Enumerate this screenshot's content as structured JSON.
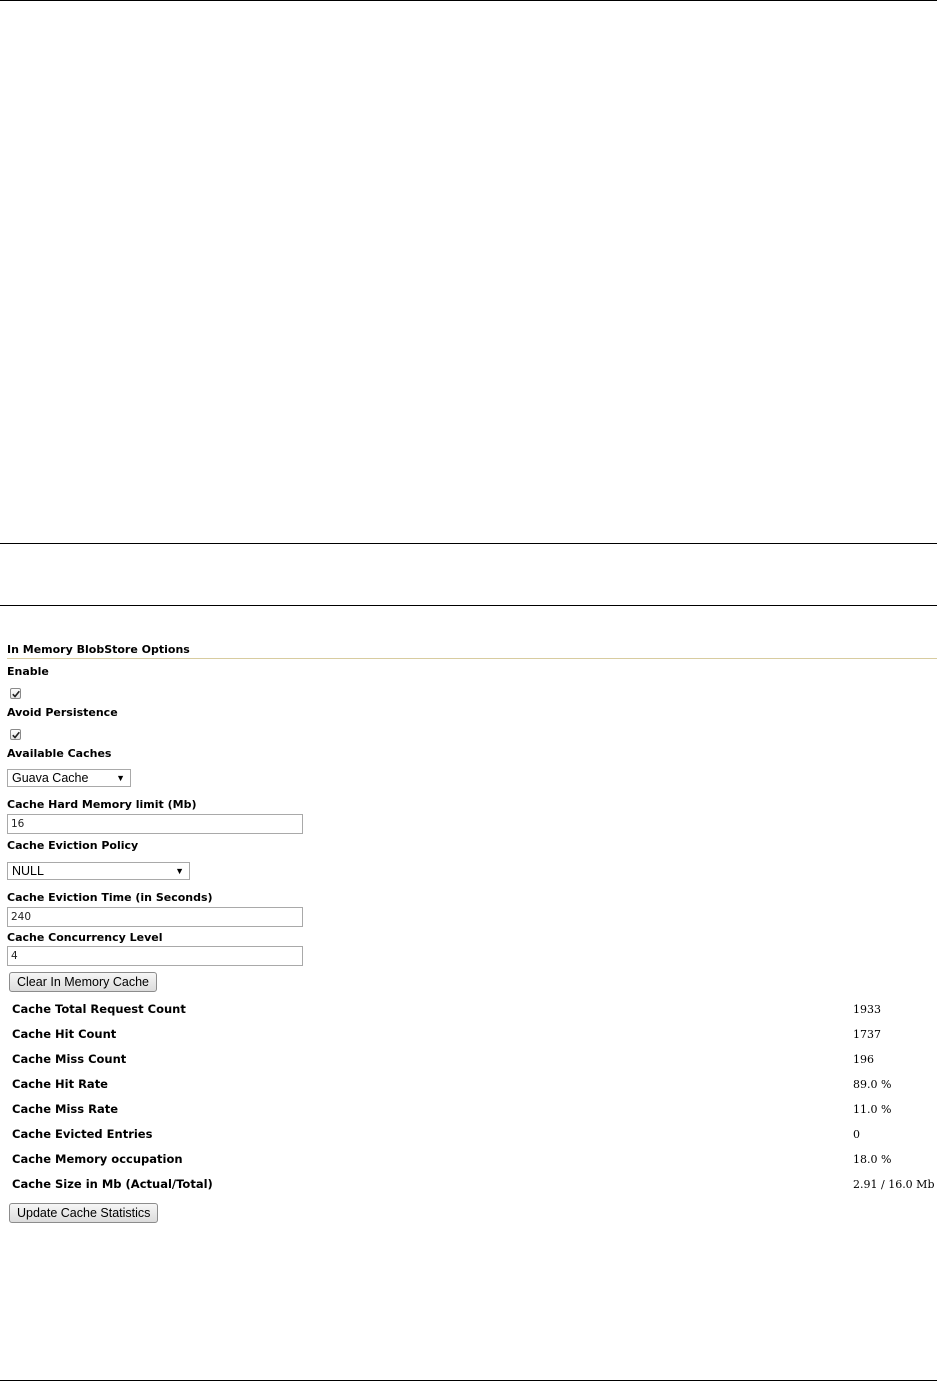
{
  "section": {
    "title": "In Memory BlobStore Options"
  },
  "enable": {
    "label": "Enable",
    "checked": true
  },
  "avoid_persistence": {
    "label": "Avoid Persistence",
    "checked": true
  },
  "available_caches": {
    "label": "Available Caches",
    "selected": "Guava Cache"
  },
  "hard_memory_limit": {
    "label": "Cache Hard Memory limit (Mb)",
    "value": "16"
  },
  "eviction_policy": {
    "label": "Cache Eviction Policy",
    "selected": "NULL"
  },
  "eviction_time": {
    "label": "Cache Eviction Time (in Seconds)",
    "value": "240"
  },
  "concurrency_level": {
    "label": "Cache Concurrency Level",
    "value": "4"
  },
  "buttons": {
    "clear": "Clear In Memory Cache",
    "update": "Update Cache Statistics"
  },
  "stats": [
    {
      "label": "Cache Total Request Count",
      "value": "1933"
    },
    {
      "label": "Cache Hit Count",
      "value": "1737"
    },
    {
      "label": "Cache Miss Count",
      "value": "196"
    },
    {
      "label": "Cache Hit Rate",
      "value": "89.0 %"
    },
    {
      "label": "Cache Miss Rate",
      "value": "11.0 %"
    },
    {
      "label": "Cache Evicted Entries",
      "value": "0"
    },
    {
      "label": "Cache Memory occupation",
      "value": "18.0 %"
    },
    {
      "label": "Cache Size in Mb (Actual/Total)",
      "value": "2.91 / 16.0 Mb"
    }
  ],
  "icons": {
    "checkmark": "checkmark-icon",
    "dropdown": "chevron-down-icon"
  }
}
